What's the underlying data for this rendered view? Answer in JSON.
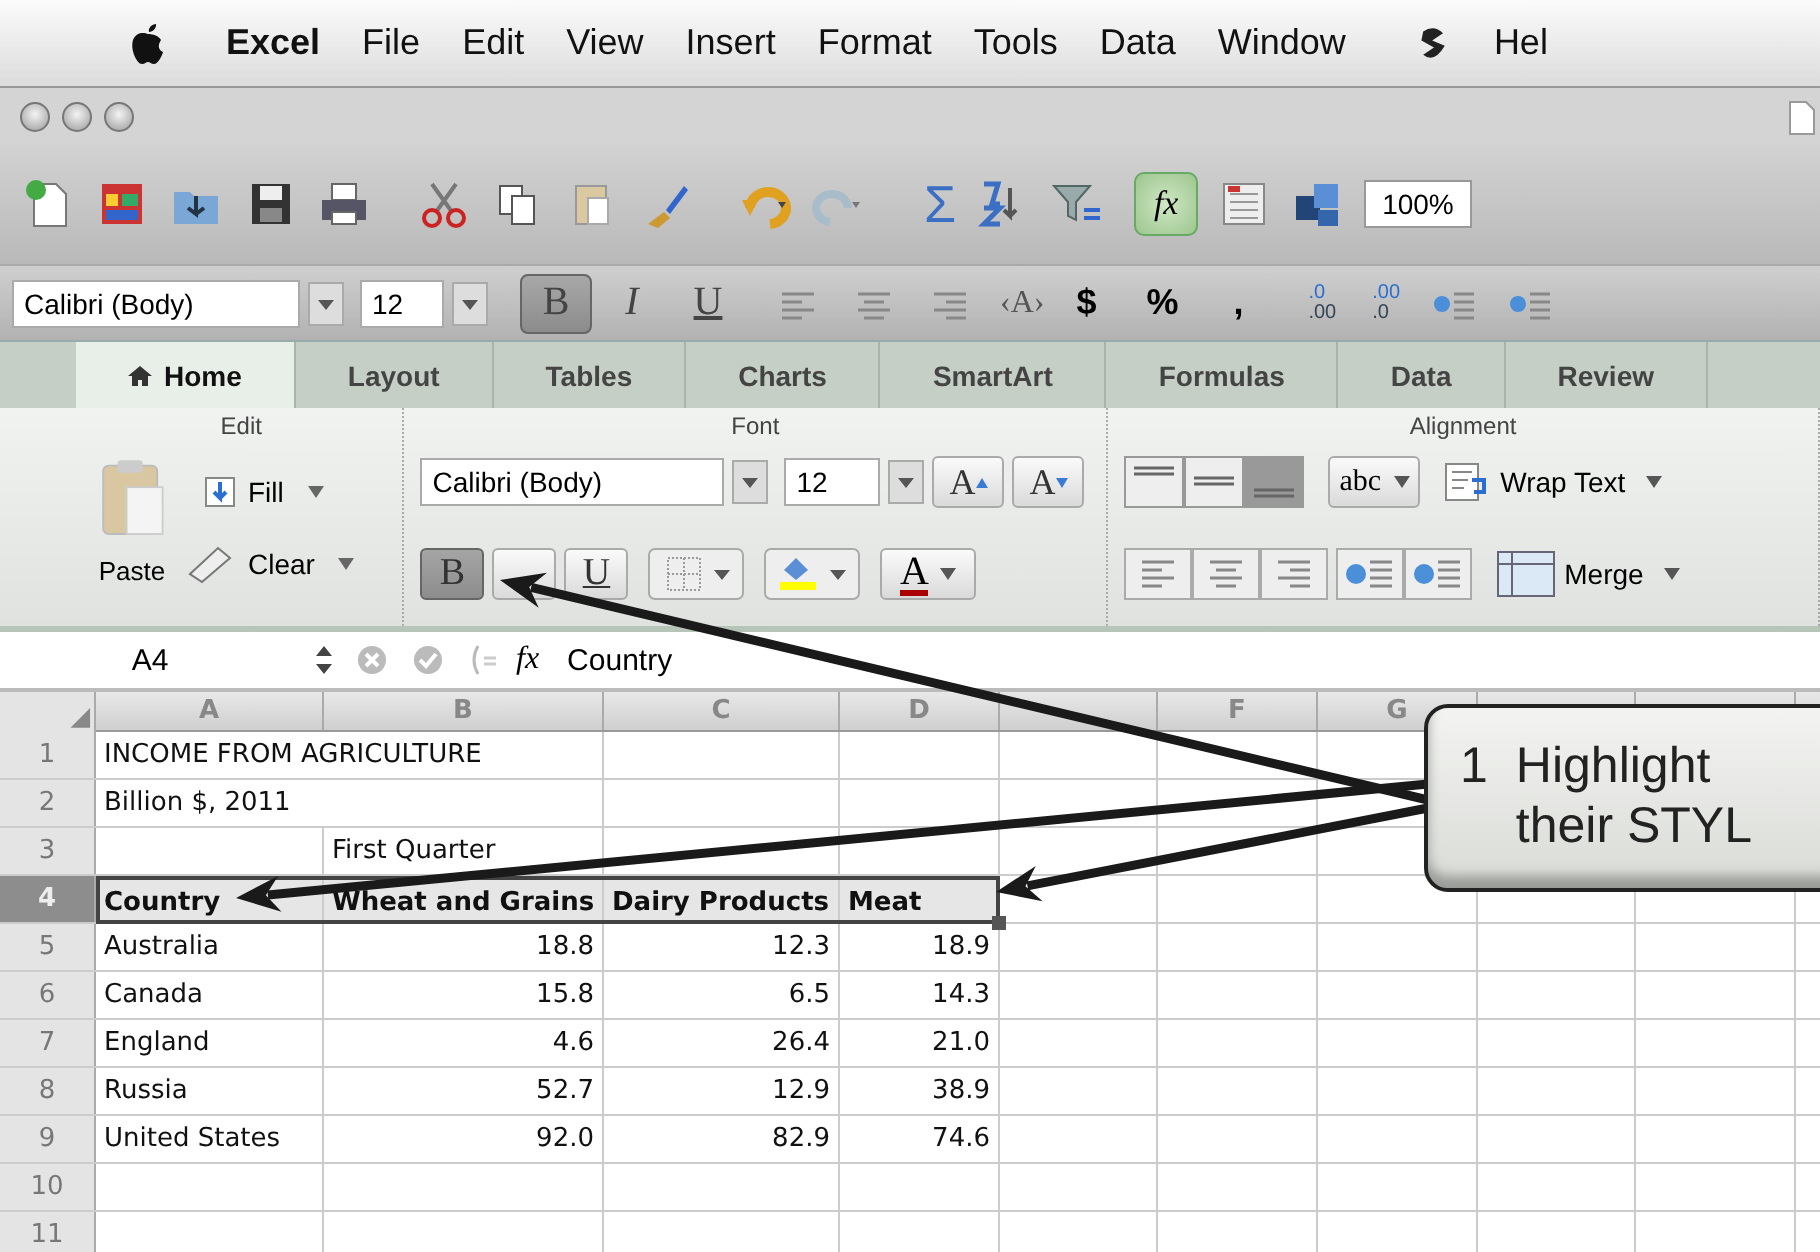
{
  "menu_bar": {
    "items": [
      {
        "label": "Excel",
        "kind": "app"
      },
      {
        "label": "File",
        "kind": "menu"
      },
      {
        "label": "Edit",
        "kind": "menu"
      },
      {
        "label": "View",
        "kind": "menu"
      },
      {
        "label": "Insert",
        "kind": "menu"
      },
      {
        "label": "Format",
        "kind": "menu"
      },
      {
        "label": "Tools",
        "kind": "menu"
      },
      {
        "label": "Data",
        "kind": "menu"
      },
      {
        "label": "Window",
        "kind": "menu"
      }
    ],
    "help": "Hel"
  },
  "toolbar": {
    "sum": "Σ",
    "function": "fx",
    "zoom": "100%"
  },
  "format_bar": {
    "font": "Calibri (Body)",
    "size": "12",
    "style_buttons": [
      {
        "label": "B",
        "selected": true
      },
      {
        "label": "I",
        "selected": false
      },
      {
        "label": "U",
        "selected": false
      }
    ],
    "shrink": "‹A›",
    "currency": "$",
    "percent": "%",
    "comma": ",",
    "decimals": [
      {
        "top": ".0",
        "bottom": ".00"
      },
      {
        "top": ".00",
        "bottom": ".0"
      }
    ]
  },
  "ribbon_tabs": [
    {
      "label": "Home",
      "selected": true
    },
    {
      "label": "Layout",
      "selected": false
    },
    {
      "label": "Tables",
      "selected": false
    },
    {
      "label": "Charts",
      "selected": false
    },
    {
      "label": "SmartArt",
      "selected": false
    },
    {
      "label": "Formulas",
      "selected": false
    },
    {
      "label": "Data",
      "selected": false
    },
    {
      "label": "Review",
      "selected": false
    }
  ],
  "ribbon": {
    "edit": {
      "title": "Edit",
      "fill": "Fill",
      "clear": "Clear",
      "paste": "Paste"
    },
    "font": {
      "title": "Font",
      "font": "Calibri (Body)",
      "size": "12",
      "grow": "A",
      "shrink": "A",
      "style_buttons": [
        {
          "label": "B",
          "selected": true
        },
        {
          "selected": false
        },
        {
          "label": "U",
          "selected": false
        }
      ],
      "font_color": "A"
    },
    "alignment": {
      "title": "Alignment",
      "vertical_align": [
        {
          "selected": false
        },
        {
          "selected": false
        },
        {
          "selected": true
        }
      ],
      "orientation": "abc",
      "wrap": "Wrap Text",
      "merge": "Merge"
    }
  },
  "formula_bar": {
    "name_box": "A4",
    "function": "fx",
    "content": "Country"
  },
  "sheet": {
    "columns": [
      "A",
      "B",
      "C",
      "D"
    ],
    "more_columns": [
      "F",
      "G"
    ],
    "rows": [
      {
        "number": "1",
        "kind": "text",
        "selected": false,
        "cells": {
          "A": "INCOME FROM AGRICULTURE"
        }
      },
      {
        "number": "2",
        "kind": "text",
        "selected": false,
        "cells": {
          "A": "Billion $, 2011"
        }
      },
      {
        "number": "3",
        "kind": "text",
        "selected": false,
        "cells": {
          "B": "First Quarter"
        }
      },
      {
        "number": "4",
        "kind": "text",
        "selected": true,
        "cells": {
          "A": "Country",
          "B": "Wheat and Grains",
          "C": "Dairy Products",
          "D": "Meat"
        }
      },
      {
        "number": "5",
        "kind": "data",
        "selected": false,
        "cells": {
          "A": "Australia",
          "B": "18.8",
          "C": "12.3",
          "D": "18.9"
        }
      },
      {
        "number": "6",
        "kind": "data",
        "selected": false,
        "cells": {
          "A": "Canada",
          "B": "15.8",
          "C": "6.5",
          "D": "14.3"
        }
      },
      {
        "number": "7",
        "kind": "data",
        "selected": false,
        "cells": {
          "A": "England",
          "B": "4.6",
          "C": "26.4",
          "D": "21.0"
        }
      },
      {
        "number": "8",
        "kind": "data",
        "selected": false,
        "cells": {
          "A": "Russia",
          "B": "52.7",
          "C": "12.9",
          "D": "38.9"
        }
      },
      {
        "number": "9",
        "kind": "data",
        "selected": false,
        "cells": {
          "A": "United States",
          "B": "92.0",
          "C": "82.9",
          "D": "74.6"
        }
      },
      {
        "number": "10",
        "kind": "text",
        "selected": false,
        "cells": {}
      },
      {
        "number": "11",
        "kind": "text",
        "selected": false,
        "cells": {}
      }
    ]
  },
  "callout": {
    "number": "1",
    "lines": [
      "Highlight",
      "their STYL"
    ]
  }
}
